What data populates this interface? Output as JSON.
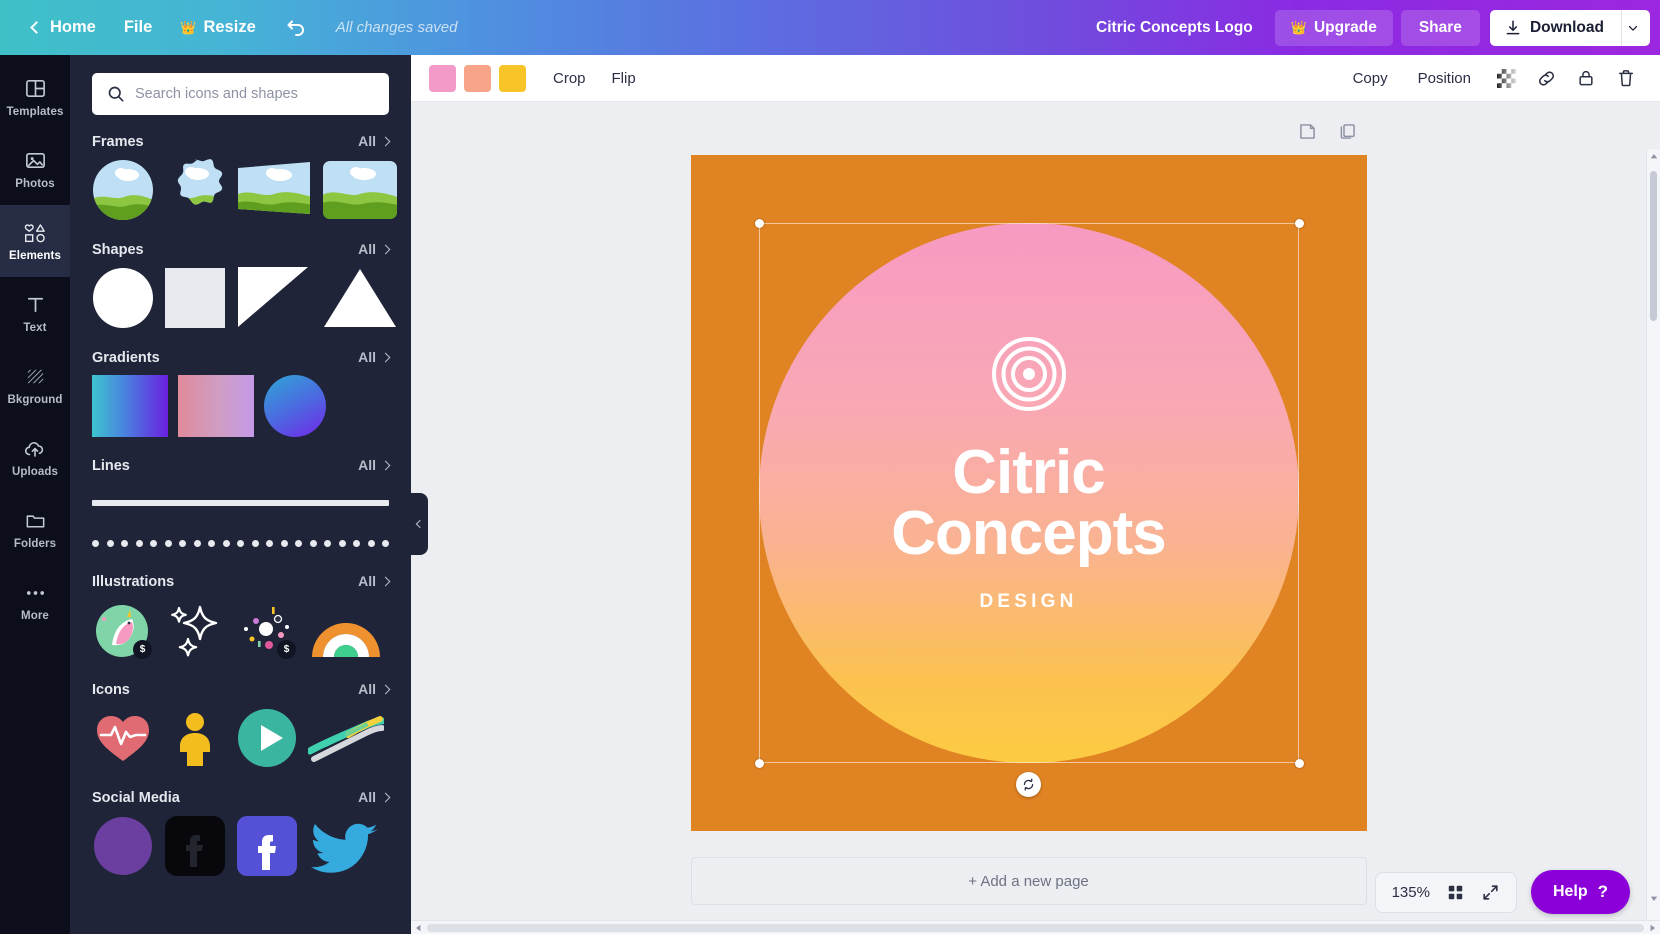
{
  "topbar": {
    "home": "Home",
    "file": "File",
    "resize": "Resize",
    "saved_status": "All changes saved",
    "doc_title": "Citric Concepts Logo",
    "upgrade": "Upgrade",
    "share": "Share",
    "download": "Download",
    "accent_start": "#3fc0c7",
    "accent_end": "#9c27e0"
  },
  "rail": {
    "items": [
      {
        "label": "Templates",
        "icon": "templates-icon",
        "active": false
      },
      {
        "label": "Photos",
        "icon": "photos-icon",
        "active": false
      },
      {
        "label": "Elements",
        "icon": "elements-icon",
        "active": true
      },
      {
        "label": "Text",
        "icon": "text-icon",
        "active": false
      },
      {
        "label": "Bkground",
        "icon": "background-icon",
        "active": false
      },
      {
        "label": "Uploads",
        "icon": "uploads-icon",
        "active": false
      },
      {
        "label": "Folders",
        "icon": "folders-icon",
        "active": false
      },
      {
        "label": "More",
        "icon": "more-icon",
        "active": false
      }
    ]
  },
  "panel": {
    "search_placeholder": "Search icons and shapes",
    "search_value": "",
    "all_label": "All",
    "sections": {
      "frames": "Frames",
      "shapes": "Shapes",
      "gradients": "Gradients",
      "lines": "Lines",
      "illustrations": "Illustrations",
      "icons": "Icons",
      "social": "Social Media"
    },
    "pay_badge": "$"
  },
  "context_toolbar": {
    "swatches": [
      "#f49ac8",
      "#f7a489",
      "#f7c527"
    ],
    "crop": "Crop",
    "flip": "Flip",
    "copy": "Copy",
    "position": "Position",
    "transparency_icon": "transparency-icon",
    "link_icon": "link-icon",
    "lock_icon": "lock-icon",
    "delete_icon": "trash-icon"
  },
  "canvas": {
    "page_note_icon": "notes-icon",
    "duplicate_page_icon": "duplicate-page-icon",
    "add_page": "+ Add a new page",
    "background_color": "#e08323",
    "design": {
      "brand_line1": "Citric",
      "brand_line2": "Concepts",
      "sub": "DESIGN",
      "gradient_top": "#f79ac2",
      "gradient_mid": "#f8b09b",
      "gradient_bottom": "#fbc749",
      "emblem_icon": "concentric-rings-icon"
    }
  },
  "footer": {
    "zoom": "135%",
    "grid_icon": "grid-view-icon",
    "fullscreen_icon": "expand-icon",
    "help": "Help",
    "help_mark": "?",
    "help_color": "#8b00d9"
  }
}
